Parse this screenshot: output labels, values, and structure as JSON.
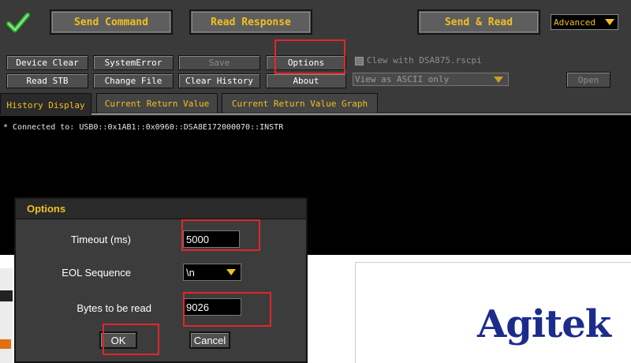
{
  "toolbar": {
    "send_command": "Send Command",
    "read_response": "Read Response",
    "send_and_read": "Send & Read",
    "mode_select": "Advanced"
  },
  "buttons": {
    "device_clear": "Device Clear",
    "system_error": "SystemError",
    "save": "Save",
    "options": "Options",
    "read_stb": "Read STB",
    "change_file": "Change File",
    "clear_history": "Clear History",
    "about": "About",
    "open": "Open"
  },
  "clew": {
    "label": "Clew with DSA875.rscpi",
    "checked": false
  },
  "view_select": "View as ASCII only",
  "tabs": [
    {
      "label": "History Display",
      "active": true
    },
    {
      "label": "Current Return Value",
      "active": false
    },
    {
      "label": "Current Return Value Graph",
      "active": false
    }
  ],
  "console": {
    "lines": [
      "* Connected to: USB0::0x1AB1::0x0960::DSA8E172000070::INSTR"
    ]
  },
  "options_dialog": {
    "title": "Options",
    "timeout_label": "Timeout (ms)",
    "timeout_value": "5000",
    "eol_label": "EOL Sequence",
    "eol_value": "\\n",
    "bytes_label": "Bytes to be read",
    "bytes_value": "9026",
    "ok": "OK",
    "cancel": "Cancel"
  },
  "logo": "Agitek",
  "colors": {
    "panel": "#3a3a3a",
    "accent_text": "#f0c020",
    "highlight": "#e3262b",
    "logo": "#1b2c8c"
  }
}
